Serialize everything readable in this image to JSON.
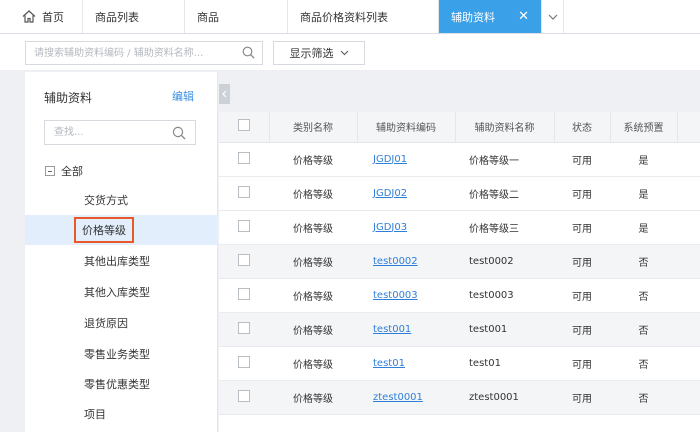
{
  "tabs": {
    "home": "首页",
    "items": [
      {
        "label": "商品列表"
      },
      {
        "label": "商品"
      },
      {
        "label": "商品价格资料列表"
      }
    ],
    "active": "辅助资料"
  },
  "search": {
    "placeholder": "请搜索辅助资料编码 / 辅助资料名称...",
    "filter_label": "显示筛选"
  },
  "left_panel": {
    "title": "辅助资料",
    "edit_label": "编辑",
    "search_placeholder": "查找...",
    "root_label": "全部",
    "items": [
      {
        "label": "交货方式"
      },
      {
        "label": "价格等级"
      },
      {
        "label": "其他出库类型"
      },
      {
        "label": "其他入库类型"
      },
      {
        "label": "退货原因"
      },
      {
        "label": "零售业务类型"
      },
      {
        "label": "零售优惠类型"
      },
      {
        "label": "项目"
      }
    ]
  },
  "table": {
    "headers": {
      "category": "类别名称",
      "code": "辅助资料编码",
      "name": "辅助资料名称",
      "status": "状态",
      "preset": "系统预置"
    },
    "rows": [
      {
        "category": "价格等级",
        "code": "JGDJ01",
        "name": "价格等级一",
        "status": "可用",
        "preset": "是"
      },
      {
        "category": "价格等级",
        "code": "JGDJ02",
        "name": "价格等级二",
        "status": "可用",
        "preset": "是"
      },
      {
        "category": "价格等级",
        "code": "JGDJ03",
        "name": "价格等级三",
        "status": "可用",
        "preset": "是"
      },
      {
        "category": "价格等级",
        "code": "test0002",
        "name": "test0002",
        "status": "可用",
        "preset": "否"
      },
      {
        "category": "价格等级",
        "code": "test0003",
        "name": "test0003",
        "status": "可用",
        "preset": "否"
      },
      {
        "category": "价格等级",
        "code": "test001",
        "name": "test001",
        "status": "可用",
        "preset": "否"
      },
      {
        "category": "价格等级",
        "code": "test01",
        "name": "test01",
        "status": "可用",
        "preset": "否"
      },
      {
        "category": "价格等级",
        "code": "ztest0001",
        "name": "ztest0001",
        "status": "可用",
        "preset": "否"
      }
    ]
  },
  "colors": {
    "active_tab": "#3aa0e8",
    "link": "#2f7fd8",
    "highlight_border": "#e8582a",
    "selected_bg": "#e2eefb"
  }
}
